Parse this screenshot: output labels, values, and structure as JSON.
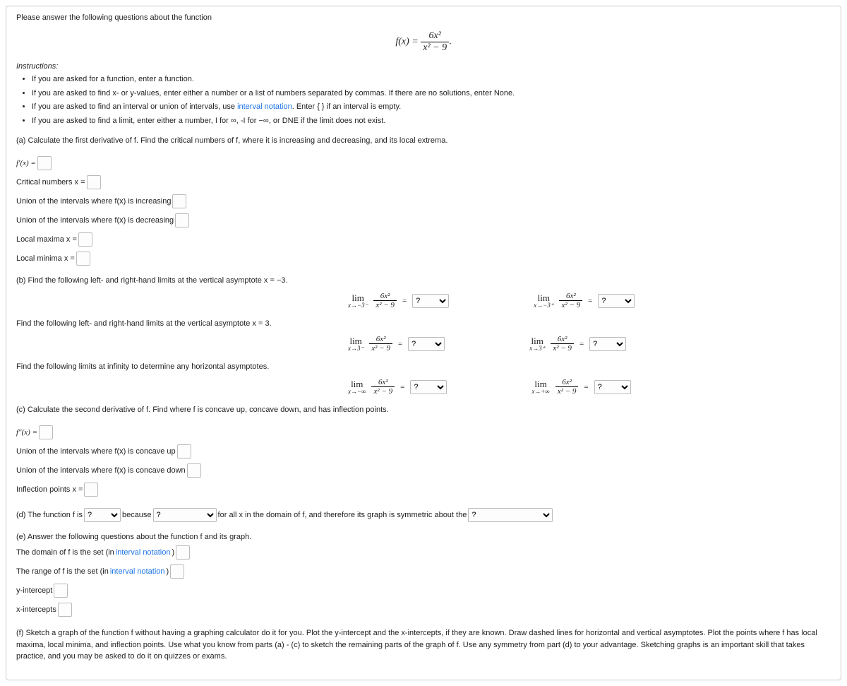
{
  "intro": "Please answer the following questions about the function",
  "func_lhs": "f(x) = ",
  "func_num": "6x²",
  "func_den": "x² − 9",
  "instructions_header": "Instructions:",
  "instructions": [
    "If you are asked for a function, enter a function.",
    "If you are asked to find x- or y-values, enter either a number or a list of numbers separated by commas. If there are no solutions, enter None.",
    "If you are asked to find an interval or union of intervals, use interval notation. Enter { } if an interval is empty.",
    "If you are asked to find a limit, enter either a number, I for ∞, -I for −∞, or DNE if the limit does not exist."
  ],
  "interval_notation": "interval notation",
  "parts": {
    "a": "(a) Calculate the first derivative of f. Find the critical numbers of f, where it is increasing and decreasing, and its local extrema.",
    "b_head": "(b) Find the following left- and right-hand limits at the vertical asymptote x = −3.",
    "b_mid": "Find the following left- and right-hand limits at the vertical asymptote x = 3.",
    "b_inf": "Find the following limits at infinity to determine any horizontal asymptotes.",
    "c": "(c) Calculate the second derivative of f. Find where f is concave up, concave down, and has inflection points.",
    "d_pre": "(d) The function f is ",
    "d_mid1": " because ",
    "d_mid2": " for all x in the domain of f, and therefore its graph is symmetric about the ",
    "e_head": "(e) Answer the following questions about the function f and its graph.",
    "f": "(f) Sketch a graph of the function f without having a graphing calculator do it for you. Plot the y-intercept and the x-intercepts, if they are known. Draw dashed lines for horizontal and vertical asymptotes. Plot the points where f has local maxima, local minima, and inflection points. Use what you know from parts (a) - (c) to sketch the remaining parts of the graph of f. Use any symmetry from part (d) to your advantage. Sketching graphs is an important skill that takes practice, and you may be asked to do it on quizzes or exams."
  },
  "labels": {
    "fprime": "f′(x) = ",
    "critical": "Critical numbers x = ",
    "increasing": "Union of the intervals where f(x) is increasing ",
    "decreasing": "Union of the intervals where f(x) is decreasing ",
    "localmax": "Local maxima x = ",
    "localmin": "Local minima x = ",
    "fdprime": "f″(x) = ",
    "concaveup": "Union of the intervals where f(x) is concave up ",
    "concavedown": "Union of the intervals where f(x) is concave down ",
    "inflection": "Inflection points x = ",
    "domain": "The domain of f is the set (in ",
    "range": "The range of f is the set (in ",
    "yint": "y-intercept ",
    "xint": "x-intercepts ",
    "paren_close": ") "
  },
  "limit_subs": {
    "neg3l": "x→−3⁻",
    "neg3r": "x→−3⁺",
    "pos3l": "x→3⁻",
    "pos3r": "x→3⁺",
    "neginf": "x→−∞",
    "posinf": "x→+∞"
  },
  "lim_word": "lim",
  "equals": " = ",
  "question": "?"
}
